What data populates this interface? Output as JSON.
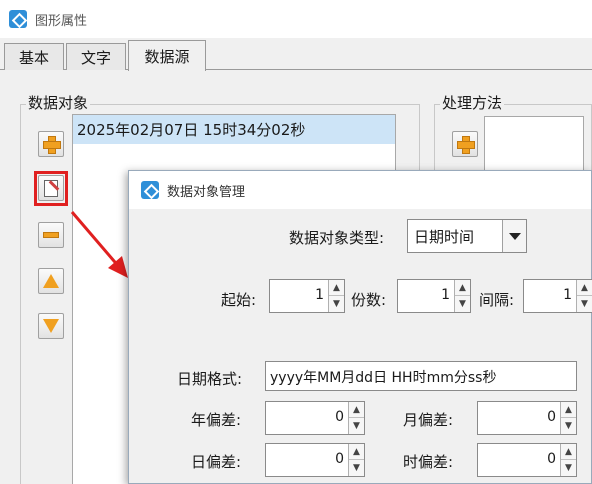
{
  "window": {
    "title": "图形属性"
  },
  "tabs": [
    {
      "label": "基本"
    },
    {
      "label": "文字"
    },
    {
      "label": "数据源"
    }
  ],
  "data_objects": {
    "group_label": "数据对象",
    "items": [
      "2025年02月07日 15时34分02秒"
    ]
  },
  "processing": {
    "group_label": "处理方法"
  },
  "dialog": {
    "title": "数据对象管理",
    "type_label": "数据对象类型:",
    "type_value": "日期时间",
    "start_label": "起始:",
    "start_value": "1",
    "copies_label": "份数:",
    "copies_value": "1",
    "interval_label": "间隔:",
    "interval_value": "1",
    "format_label": "日期格式:",
    "format_value": "yyyy年MM月dd日 HH时mm分ss秒",
    "year_offset_label": "年偏差:",
    "year_offset_value": "0",
    "month_offset_label": "月偏差:",
    "month_offset_value": "0",
    "day_offset_label": "日偏差:",
    "day_offset_value": "0",
    "hour_offset_label": "时偏差:",
    "hour_offset_value": "0"
  },
  "colors": {
    "highlight_red": "#e02020",
    "accent_orange": "#f0a020",
    "selection": "#cde4f7"
  }
}
